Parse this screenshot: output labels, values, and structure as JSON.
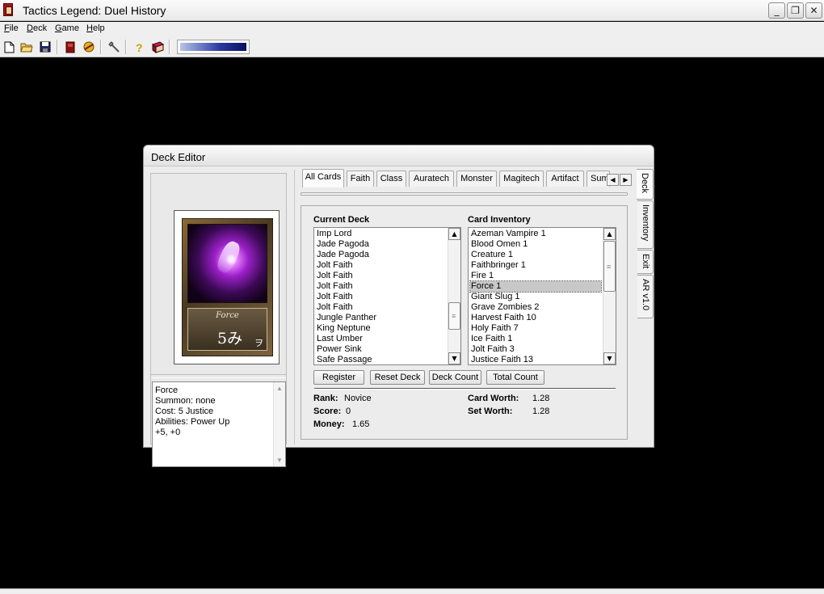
{
  "window": {
    "title": "Tactics Legend: Duel History",
    "minimize_glyph": "_",
    "restore_glyph": "❐",
    "close_glyph": "✕"
  },
  "menu": {
    "file_accel": "F",
    "file_rest": "ile",
    "deck_accel": "D",
    "deck_rest": "eck",
    "game_accel": "G",
    "game_rest": "ame",
    "help_accel": "H",
    "help_rest": "elp"
  },
  "toolbar": {
    "icons": [
      "new-document-icon",
      "open-folder-icon",
      "save-disk-icon",
      "deck-book-icon",
      "trade-icon",
      "tools-icon",
      "help-question-icon",
      "manual-book-icon"
    ],
    "progress_percent": 100
  },
  "dialog": {
    "title": "Deck Editor",
    "tabs": [
      "All Cards",
      "Faith",
      "Class",
      "Auratech",
      "Monster",
      "Magitech",
      "Artifact",
      "Sum"
    ],
    "tab_left_arrow": "◀",
    "tab_right_arrow": "▶",
    "side_tabs": [
      "Deck",
      "Inventory",
      "Exit",
      "AR v1.0"
    ],
    "card": {
      "name": "Force",
      "cost_display": "5み",
      "cost_mark": "ヲ"
    },
    "info_lines": [
      "Force",
      "Summon: none",
      "Cost: 5 Justice",
      "Abilities: Power Up",
      "+5, +0"
    ],
    "current_deck": {
      "header": "Current Deck",
      "items": [
        "Imp Lord",
        "Jade Pagoda",
        "Jade Pagoda",
        "Jolt Faith",
        "Jolt Faith",
        "Jolt Faith",
        "Jolt Faith",
        "Jolt Faith",
        "Jungle Panther",
        "King Neptune",
        "Last Umber",
        "Power Sink",
        "Safe Passage"
      ]
    },
    "inventory": {
      "header": "Card Inventory",
      "items": [
        "Azeman Vampire  1",
        "Blood Omen  1",
        "Creature  1",
        "Faithbringer  1",
        "Fire  1",
        "Force  1",
        "Giant Slug  1",
        "Grave Zombies  2",
        "Harvest Faith  10",
        "Holy Faith  7",
        "Ice Faith  1",
        "Jolt Faith  3",
        "Justice Faith  13"
      ],
      "selected_index": 5
    },
    "scroll_up": "▲",
    "scroll_down": "▼",
    "buttons": {
      "register": "Register",
      "reset_deck": "Reset Deck",
      "deck_count": "Deck Count",
      "total_count": "Total Count"
    },
    "stats": {
      "rank_label": "Rank:",
      "rank_value": "Novice",
      "score_label": "Score:",
      "score_value": "0",
      "money_label": "Money:",
      "money_value": "1.65",
      "card_worth_label": "Card Worth:",
      "card_worth_value": "1.28",
      "set_worth_label": "Set Worth:",
      "set_worth_value": "1.28"
    }
  }
}
